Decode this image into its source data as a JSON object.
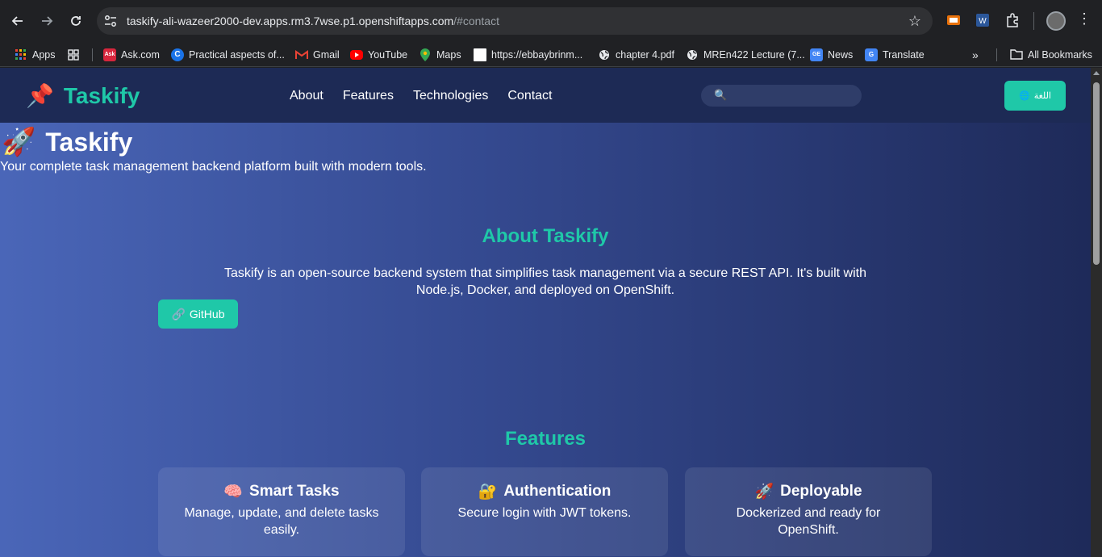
{
  "browser": {
    "url_main": "taskify-ali-wazeer2000-dev.apps.rm3.7wse.p1.openshiftapps.com",
    "url_fragment": "/#contact",
    "bookmarks": [
      {
        "label": "Apps",
        "icon": "apps-grid-icon"
      },
      {
        "label": "",
        "icon": "grid-icon"
      },
      {
        "label": "Ask.com",
        "icon": "ask-icon"
      },
      {
        "label": "Practical aspects of...",
        "icon": "c-logo-icon"
      },
      {
        "label": "Gmail",
        "icon": "gmail-icon"
      },
      {
        "label": "YouTube",
        "icon": "youtube-icon"
      },
      {
        "label": "Maps",
        "icon": "maps-icon"
      },
      {
        "label": "https://ebbaybrinm...",
        "icon": "blank-page-icon"
      },
      {
        "label": "chapter 4.pdf",
        "icon": "globe-icon"
      },
      {
        "label": "MREn422 Lecture (7...",
        "icon": "globe-icon"
      },
      {
        "label": "News",
        "icon": "news-icon"
      },
      {
        "label": "Translate",
        "icon": "translate-icon"
      }
    ],
    "all_bookmarks_label": "All Bookmarks"
  },
  "site": {
    "logo_icon": "📌",
    "logo_text": "Taskify",
    "nav": [
      "About",
      "Features",
      "Technologies",
      "Contact"
    ],
    "search_icon": "🔍",
    "search_placeholder": "",
    "lang_button": "اللغة",
    "lang_icon": "🌐"
  },
  "hero": {
    "icon": "🚀",
    "title": "Taskify",
    "subtitle": "Your complete task management backend platform built with modern tools."
  },
  "about": {
    "title": "About Taskify",
    "body": "Taskify is an open-source backend system that simplifies task management via a secure REST API. It's built with Node.js, Docker, and deployed on OpenShift.",
    "github_icon": "🔗",
    "github_label": "GitHub"
  },
  "features": {
    "title": "Features",
    "cards": [
      {
        "icon": "🧠",
        "title": "Smart Tasks",
        "desc": "Manage, update, and delete tasks easily."
      },
      {
        "icon": "🔐",
        "title": "Authentication",
        "desc": "Secure login with JWT tokens."
      },
      {
        "icon": "🚀",
        "title": "Deployable",
        "desc": "Dockerized and ready for OpenShift."
      }
    ]
  },
  "colors": {
    "accent": "#1fc8a8",
    "header_bg": "#1d2a55",
    "page_gradient_left": "#4a66b8",
    "page_gradient_right": "#1e2a59"
  }
}
